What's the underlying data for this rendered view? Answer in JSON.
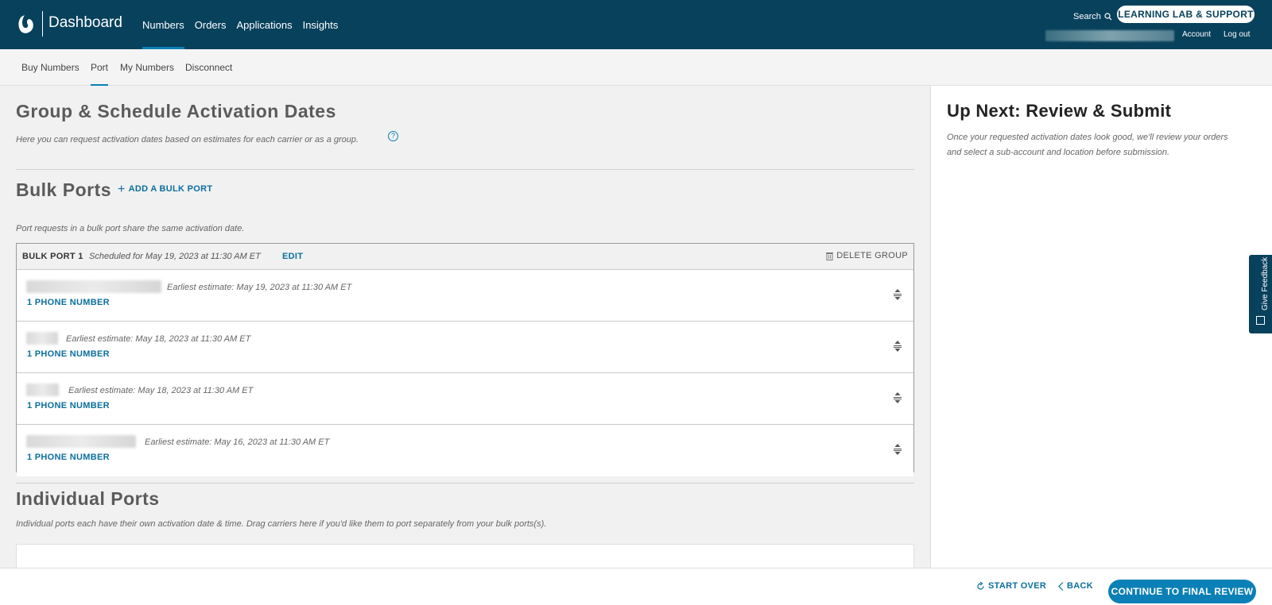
{
  "topbar": {
    "app_title": "Dashboard",
    "nav": [
      {
        "label": "Numbers",
        "active": true
      },
      {
        "label": "Orders"
      },
      {
        "label": "Applications"
      },
      {
        "label": "Insights"
      }
    ],
    "search_label": "Search",
    "support_button": "LEARNING LAB & SUPPORT",
    "account_link": "Account",
    "logout_link": "Log out"
  },
  "subnav": {
    "items": [
      {
        "label": "Buy Numbers"
      },
      {
        "label": "Port",
        "active": true
      },
      {
        "label": "My Numbers"
      },
      {
        "label": "Disconnect"
      }
    ]
  },
  "main": {
    "title": "Group & Schedule Activation Dates",
    "description": "Here you can request activation dates based on estimates for each carrier or as a group.",
    "help_icon": "?",
    "bulk": {
      "title": "Bulk Ports",
      "add_label": "ADD A BULK PORT",
      "description": "Port requests in a bulk port share the same activation date.",
      "group": {
        "name": "BULK PORT 1",
        "schedule": "Scheduled for May 19, 2023 at 11:30 AM ET",
        "edit_label": "EDIT",
        "delete_label": "DELETE GROUP",
        "rows": [
          {
            "estimate": "Earliest estimate: May 19, 2023 at 11:30 AM ET",
            "phone_label": "1 PHONE NUMBER"
          },
          {
            "estimate": "Earliest estimate: May 18, 2023 at 11:30 AM ET",
            "phone_label": "1 PHONE NUMBER"
          },
          {
            "estimate": "Earliest estimate: May 18, 2023 at 11:30 AM ET",
            "phone_label": "1 PHONE NUMBER"
          },
          {
            "estimate": "Earliest estimate: May 16, 2023 at 11:30 AM ET",
            "phone_label": "1 PHONE NUMBER"
          }
        ]
      }
    },
    "individual": {
      "title": "Individual Ports",
      "description": "Individual ports each have their own activation date & time. Drag carriers here if you'd like them to port separately from your bulk ports(s)."
    }
  },
  "sidebar": {
    "title": "Up Next: Review & Submit",
    "description": "Once your requested activation dates look good, we'll review your orders and select a sub-account and location before submission."
  },
  "feedback": {
    "label": "Give Feedback"
  },
  "footer": {
    "start_over": "START OVER",
    "back": "BACK",
    "continue": "CONTINUE TO FINAL REVIEW"
  },
  "colors": {
    "header_bg": "#08415c",
    "accent": "#0b80b6",
    "link": "#0b6f9e"
  },
  "icons": [
    "logo-icon",
    "search-icon",
    "help-icon",
    "plus-icon",
    "trash-icon",
    "drag-handle-icon",
    "refresh-icon",
    "chevron-left-icon",
    "feedback-icon"
  ]
}
